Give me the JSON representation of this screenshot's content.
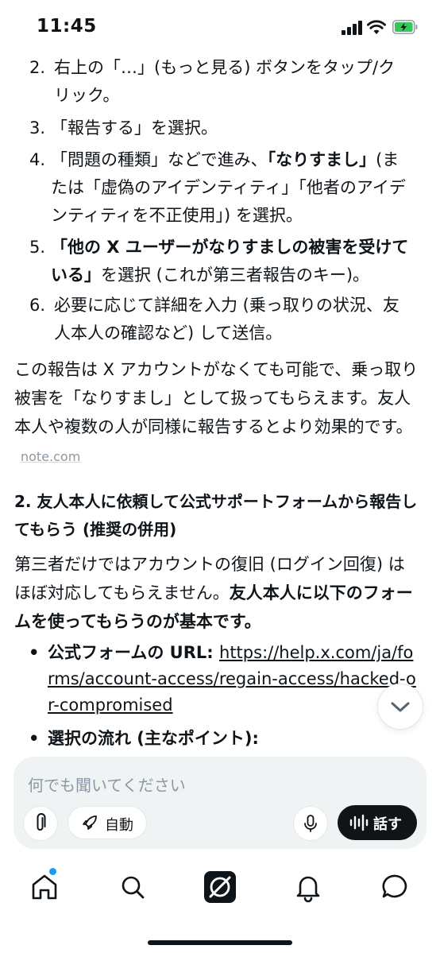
{
  "status_bar": {
    "time": "11:45"
  },
  "steps": [
    {
      "num": "2.",
      "parts": [
        {
          "text": "右上の「…」(もっと見る) ボタンをタップ/クリック。",
          "bold": false
        }
      ]
    },
    {
      "num": "3.",
      "parts": [
        {
          "text": "「報告する」を選択。",
          "bold": false
        }
      ]
    },
    {
      "num": "4.",
      "parts": [
        {
          "text": "「問題の種類」などで進み、",
          "bold": false
        },
        {
          "text": "「なりすまし」",
          "bold": true
        },
        {
          "text": "(または「虚偽のアイデンティティ」「他者のアイデンティティを不正使用」) を選択。",
          "bold": false
        }
      ]
    },
    {
      "num": "5.",
      "parts": [
        {
          "text": "「他の X ユーザーがなりすましの被害を受けている」",
          "bold": true
        },
        {
          "text": "を選択 (これが第三者報告のキー)。",
          "bold": false
        }
      ]
    },
    {
      "num": "6.",
      "parts": [
        {
          "text": "必要に応じて詳細を入力 (乗っ取りの状況、友人本人の確認など) して送信。",
          "bold": false
        }
      ]
    }
  ],
  "paragraph1": "この報告は X アカウントがなくても可能で、乗っ取り被害を「なりすまし」として扱ってもらえます。友人本人や複数の人が同様に報告するとより効果的です。",
  "source_link": "note.com",
  "section_heading": "2. 友人本人に依頼して公式サポートフォームから報告してもらう (推奨の併用)",
  "paragraph2_normal": "第三者だけではアカウントの復旧 (ログイン回復) はほぼ対応してもらえません。",
  "paragraph2_bold": "友人本人に以下のフォームを使ってもらうのが基本です。",
  "bullets": [
    {
      "label": "公式フォームの URL",
      "separator": ": ",
      "url": "https://help.x.com/ja/forms/account-access/regain-access/hacked-or-compromised"
    },
    {
      "label": "選択の流れ (主なポイント):"
    }
  ],
  "composer": {
    "placeholder": "何でも聞いてください",
    "auto_label": "自動",
    "speak_label": "話す"
  },
  "icons": {
    "scroll_down": "chevron-down-icon",
    "attach": "paperclip-icon",
    "auto": "rocket-icon",
    "mic": "microphone-icon",
    "speak": "waveform-icon",
    "nav": [
      "home-icon",
      "search-icon",
      "grok-icon",
      "bell-icon",
      "message-icon"
    ]
  },
  "colors": {
    "accent": "#1d9bf0",
    "text": "#0f1419",
    "muted": "#8b98a5",
    "composer_bg": "#eff3f4"
  }
}
